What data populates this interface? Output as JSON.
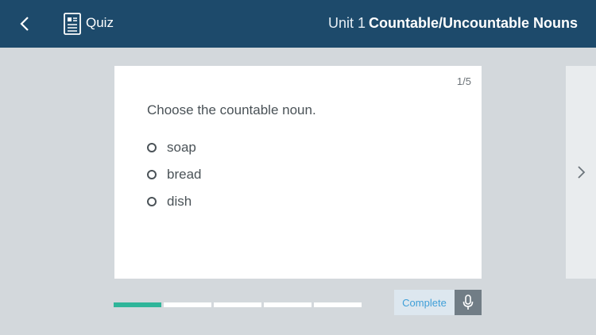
{
  "header": {
    "back_icon": "chevron-left-icon",
    "quiz_icon": "document-icon",
    "quiz_label": "Quiz",
    "unit_label": "Unit 1",
    "topic_title": "Countable/Uncountable Nouns"
  },
  "question_card": {
    "counter": "1/5",
    "question": "Choose the countable noun.",
    "options": [
      {
        "label": "soap"
      },
      {
        "label": "bread"
      },
      {
        "label": "dish"
      }
    ]
  },
  "navigation": {
    "next_icon": "chevron-right-icon"
  },
  "progress": {
    "current": 1,
    "total": 5
  },
  "footer": {
    "complete_label": "Complete",
    "mic_icon": "microphone-icon"
  },
  "colors": {
    "header_bg": "#1d4a6b",
    "page_bg": "#d3d8dc",
    "progress_active": "#2fb59a",
    "complete_text": "#3f9fd8"
  }
}
